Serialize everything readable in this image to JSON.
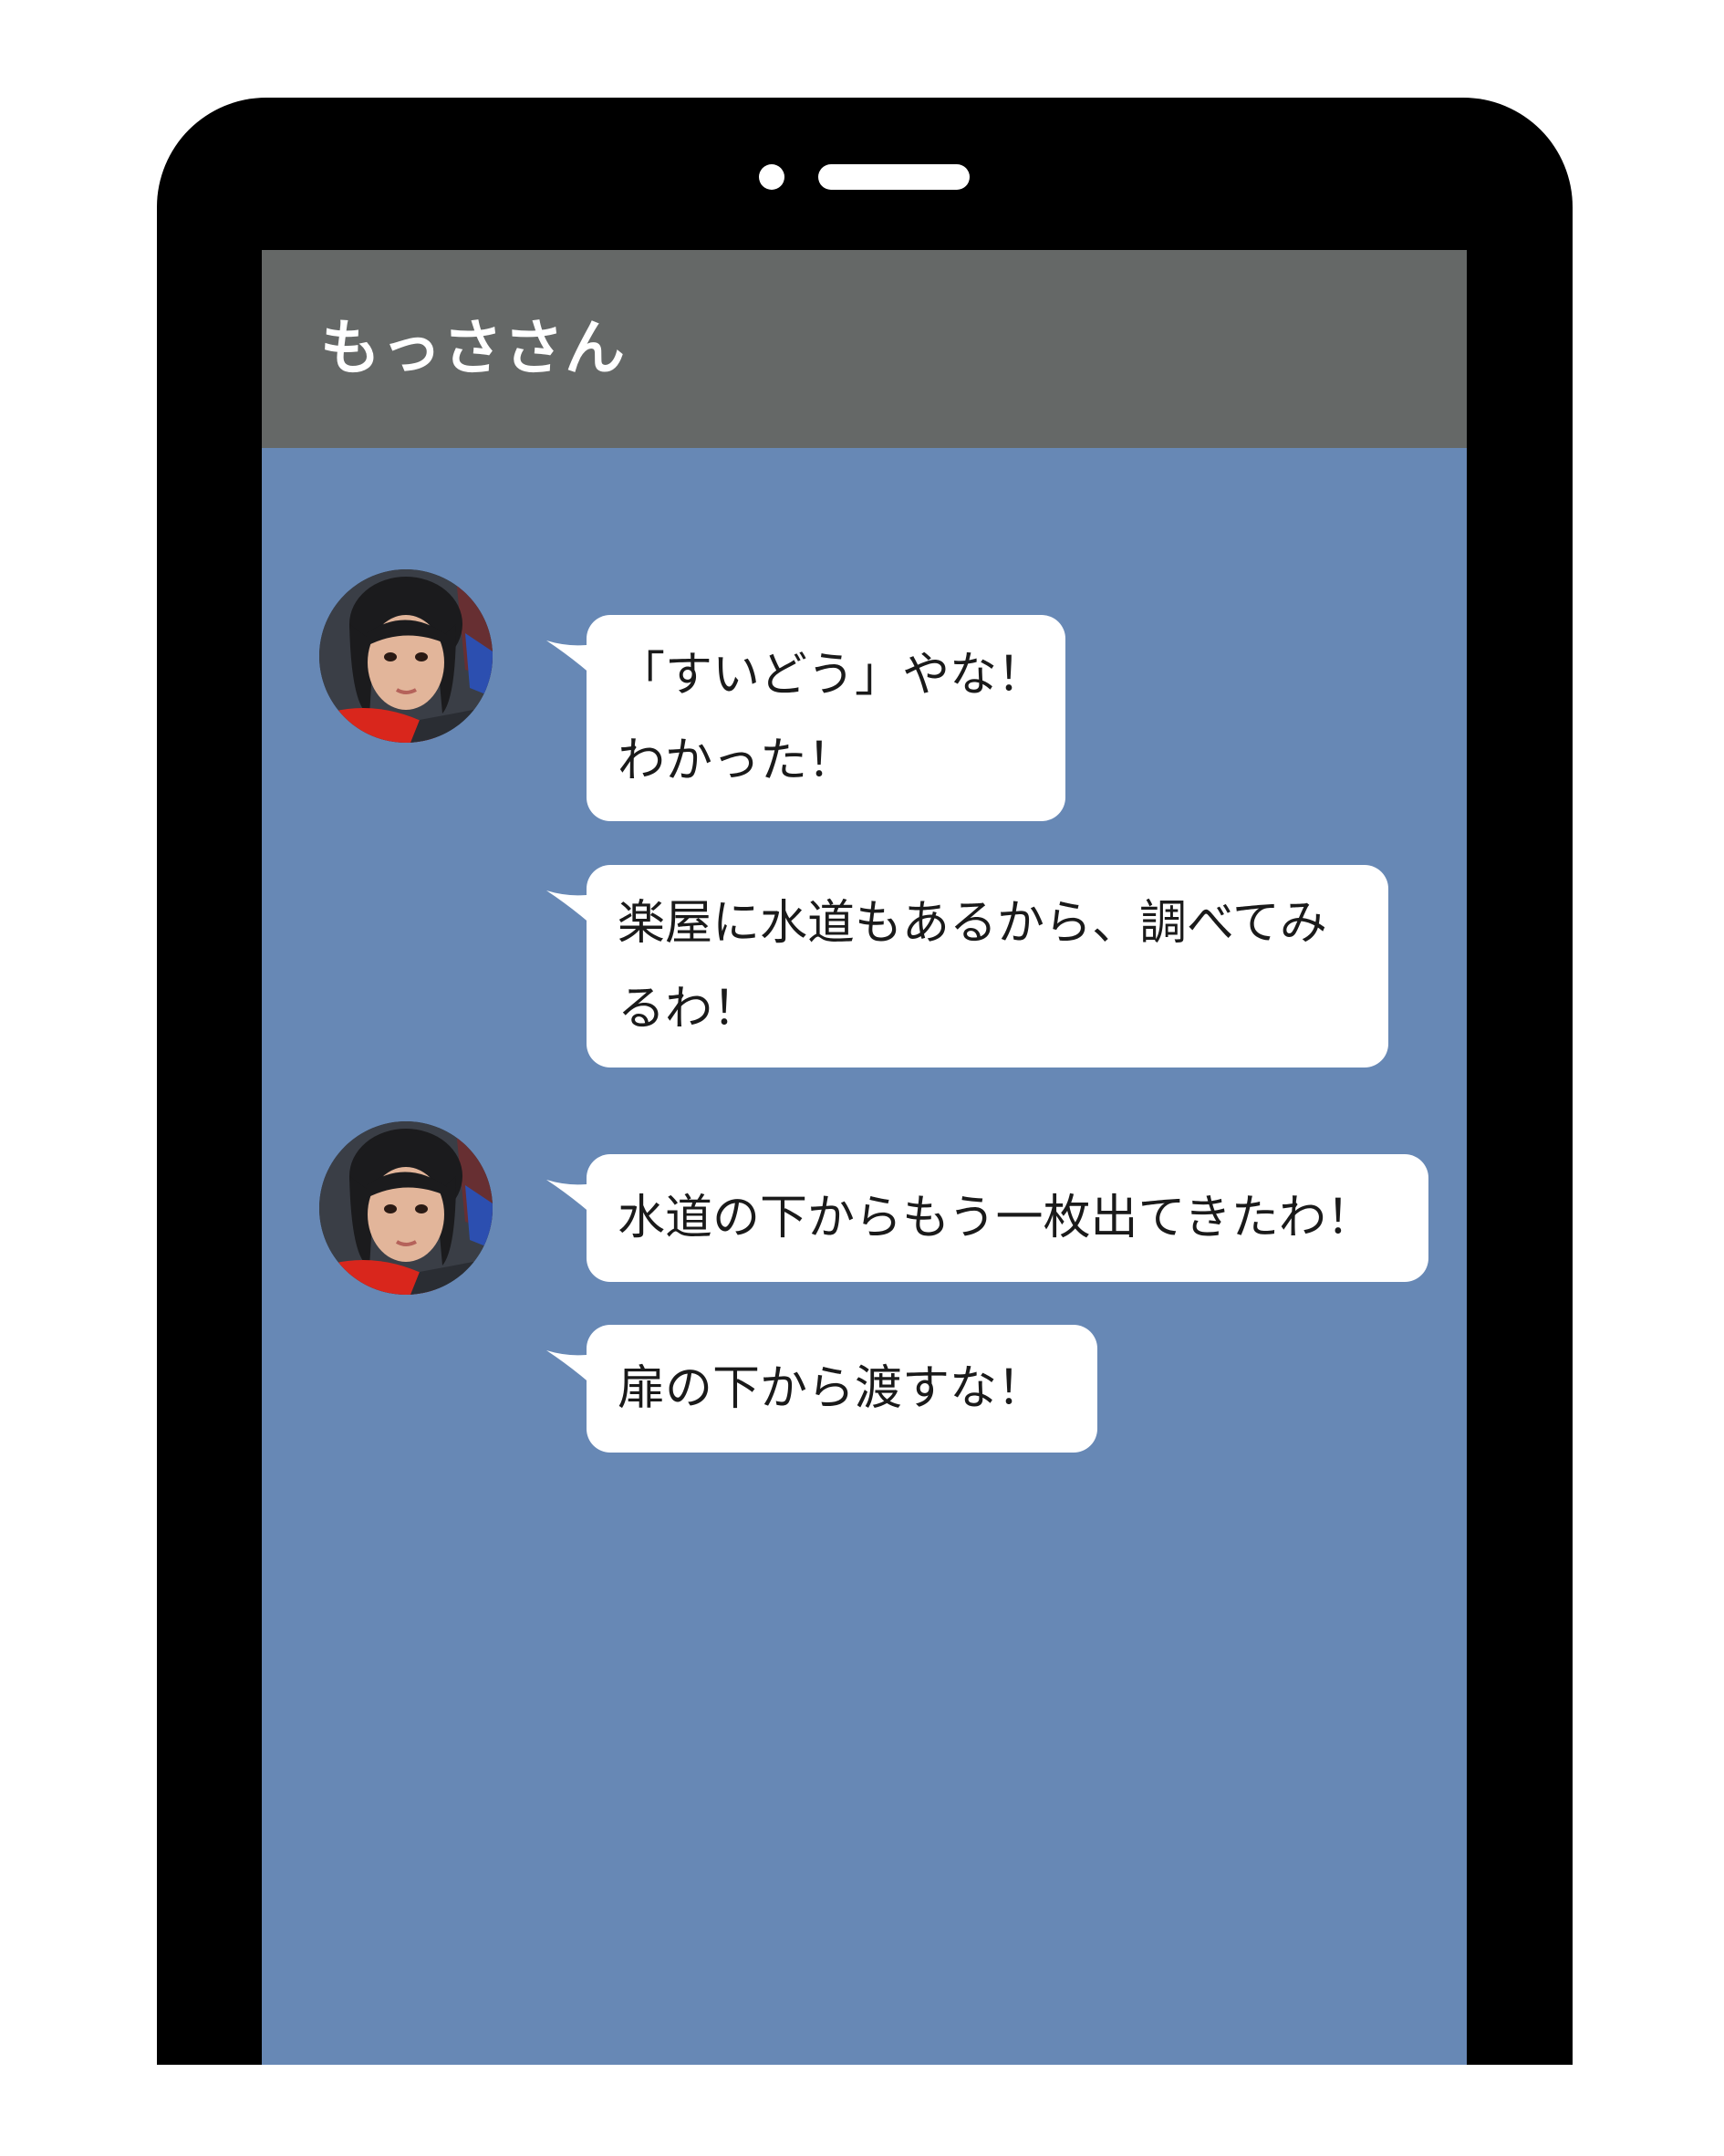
{
  "chat": {
    "title": "もっささん",
    "messages": [
      {
        "line1": "「すいどう」やな！",
        "line2": "わかった！"
      },
      {
        "line1": "楽屋に水道もあるから、調べてみ",
        "line2": "るわ！"
      },
      {
        "line1": "水道の下からもう一枚出てきたわ！"
      },
      {
        "line1": "扉の下から渡すな！"
      }
    ]
  },
  "colors": {
    "phone_body": "#000000",
    "header_bg": "#656867",
    "chat_bg": "#6788b5",
    "bubble_bg": "#ffffff",
    "accent_red": "#d9261c"
  }
}
